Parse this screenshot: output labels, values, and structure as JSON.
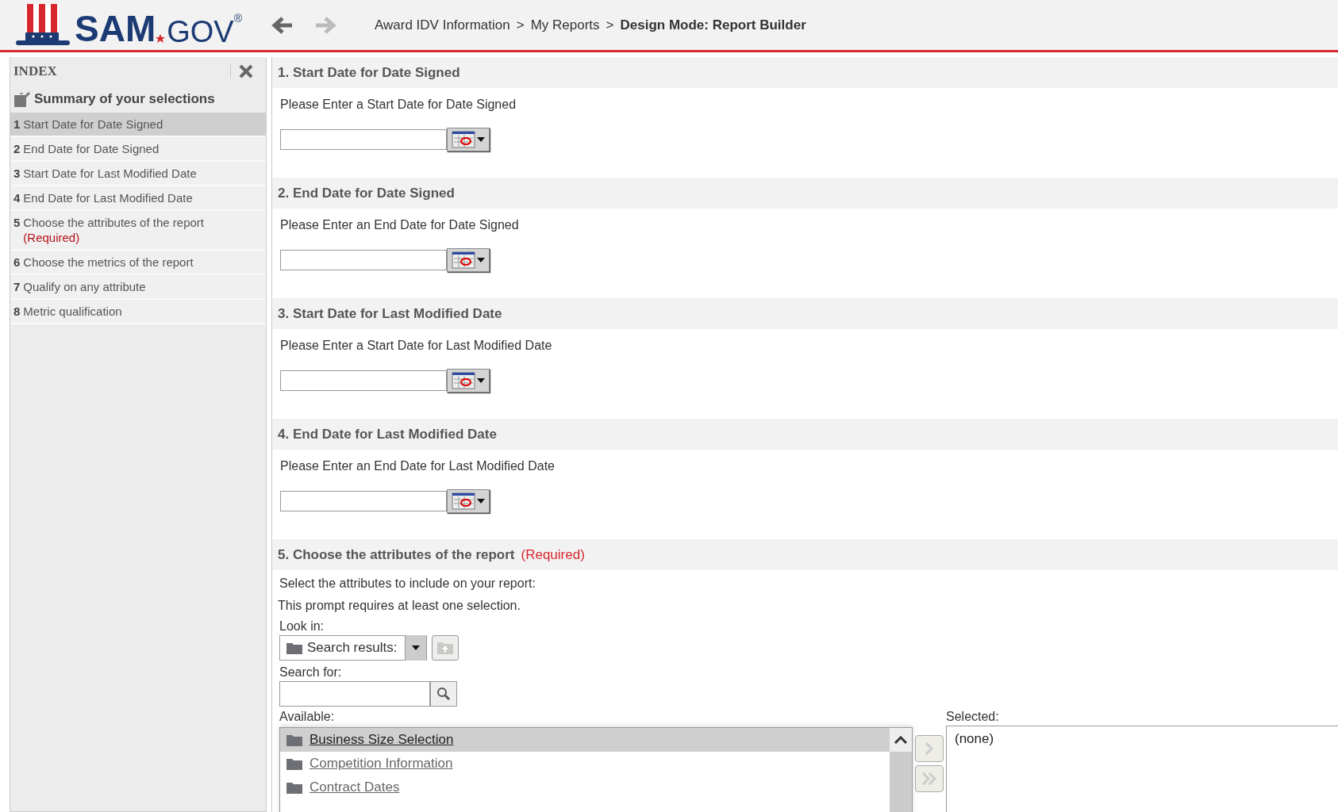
{
  "header": {
    "logo": {
      "name": "SAM",
      "suffix": "GOV",
      "mark": "®"
    },
    "nav": [
      {
        "kind": "back",
        "disabled": false
      },
      {
        "kind": "forward",
        "disabled": true
      }
    ],
    "separator": ">",
    "breadcrumb": [
      {
        "label": "Award IDV Information",
        "current": false
      },
      {
        "label": "My Reports",
        "current": false
      },
      {
        "label": "Design Mode: Report Builder",
        "current": true
      }
    ]
  },
  "sidebar": {
    "title": "INDEX",
    "summary": "Summary of your selections",
    "items": [
      {
        "number": "1",
        "label": "Start Date for Date Signed",
        "selected": true
      },
      {
        "number": "2",
        "label": "End Date for Date Signed",
        "selected": false
      },
      {
        "number": "3",
        "label": "Start Date for Last Modified Date",
        "selected": false
      },
      {
        "number": "4",
        "label": "End Date for Last Modified Date",
        "selected": false
      },
      {
        "number": "5",
        "label": "Choose the attributes of the report",
        "required": "(Required)",
        "selected": false
      },
      {
        "number": "6",
        "label": "Choose the metrics of the report",
        "selected": false
      },
      {
        "number": "7",
        "label": "Qualify on any attribute",
        "selected": false
      },
      {
        "number": "8",
        "label": "Metric qualification",
        "selected": false
      }
    ]
  },
  "sections": [
    {
      "kind": "date",
      "number": "1.",
      "title": "Start Date for Date Signed",
      "prompt": "Please Enter a Start Date for Date Signed"
    },
    {
      "kind": "date",
      "number": "2.",
      "title": "End Date for Date Signed",
      "prompt": "Please Enter an End Date for Date Signed"
    },
    {
      "kind": "date",
      "number": "3.",
      "title": "Start Date for Last Modified Date",
      "prompt": "Please Enter a Start Date for Last Modified Date"
    },
    {
      "kind": "date",
      "number": "4.",
      "title": "End Date for Last Modified Date",
      "prompt": "Please Enter an End Date for Last Modified Date"
    },
    {
      "kind": "attributes",
      "number": "5.",
      "title": "Choose the attributes of the report",
      "required": "(Required)",
      "prompt": "Select the attributes to include on your report:",
      "note": "This prompt requires at least one selection.",
      "look_in": {
        "label": "Look in:",
        "value": "Search results:"
      },
      "search_for": {
        "label": "Search for:"
      },
      "available": {
        "label": "Available:",
        "items": [
          {
            "label": "Business Size Selection",
            "selected": true
          },
          {
            "label": "Competition Information",
            "selected": false
          },
          {
            "label": "Contract Dates",
            "selected": false
          }
        ]
      },
      "selected": {
        "label": "Selected:",
        "items": [
          "(none)"
        ]
      }
    }
  ]
}
